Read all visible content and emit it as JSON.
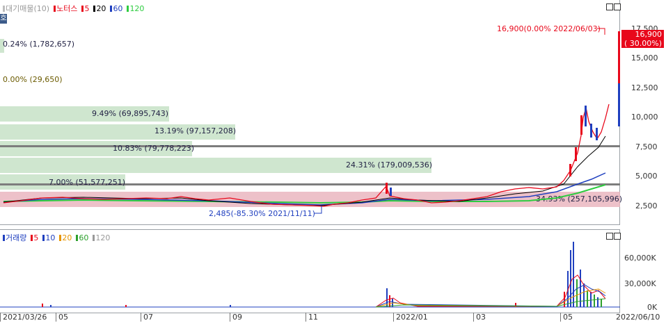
{
  "price_legend": {
    "items": [
      {
        "label": "대기매물(10)",
        "color": "#bdbdbd"
      },
      {
        "label": "노터스",
        "color": "#e8081b"
      },
      {
        "label": "5",
        "color": "#e8081b"
      },
      {
        "label": "20",
        "color": "#000000"
      },
      {
        "label": "60",
        "color": "#1f3fbf"
      },
      {
        "label": "120",
        "color": "#2ecc40"
      }
    ]
  },
  "volume_legend": {
    "items": [
      {
        "label": "거래량",
        "color": "#1f3fbf"
      },
      {
        "label": "5",
        "color": "#e8081b"
      },
      {
        "label": "10",
        "color": "#1f3fbf"
      },
      {
        "label": "20",
        "color": "#e69500"
      },
      {
        "label": "60",
        "color": "#2ca02c"
      },
      {
        "label": "120",
        "color": "#9a9a9a"
      }
    ]
  },
  "side_tab": {
    "label": "호"
  },
  "price_axis": {
    "ticks": [
      "17,500",
      "15,000",
      "12,500",
      "10,000",
      "7,500",
      "5,000",
      "2,500"
    ]
  },
  "volume_axis": {
    "ticks": [
      "60,000K",
      "30,000K",
      "0K"
    ]
  },
  "x_axis": {
    "ticks": [
      "2021/03/26",
      "05",
      "07",
      "09",
      "11",
      "2022/01",
      "03",
      "05",
      "2022/06/10"
    ]
  },
  "volume_profile": [
    {
      "text": "0.24% (1,782,657)",
      "pct": 0.24
    },
    {
      "text": "0.00% (29,650)",
      "pct": 0.0
    },
    {
      "text": "9.49% (69,895,743)",
      "pct": 9.49
    },
    {
      "text": "13.19% (97,157,208)",
      "pct": 13.19
    },
    {
      "text": "10.83% (79,778,223)",
      "pct": 10.83
    },
    {
      "text": "24.31% (179,009,536)",
      "pct": 24.31
    },
    {
      "text": "7.00% (51,577,251)",
      "pct": 7.0
    },
    {
      "text": "34.93% (257,105,996)",
      "pct": 34.93
    }
  ],
  "current_price": {
    "value": "16,900",
    "change": "( 30.00%)"
  },
  "annotations": {
    "high": "16,900(0.00% 2022/06/03)",
    "low": "2,485(-85.30% 2021/11/11)"
  },
  "colors": {
    "up": "#e8081b",
    "down": "#1f3fbf",
    "profile": "#cfe6cf",
    "band": "#eab6c0"
  }
}
